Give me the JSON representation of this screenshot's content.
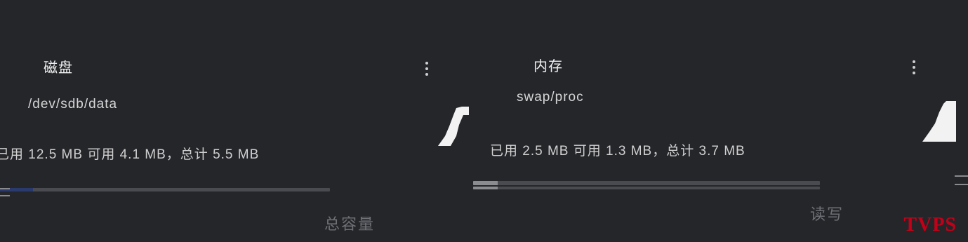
{
  "left_card": {
    "title": "磁盘",
    "subtitle": "/dev/sdb/data",
    "stats": "已用 12.5 MB 可用 4.1 MB，总计 5.5 MB",
    "progress_fraction": 0.1,
    "menu_icon": "more-vertical-icon",
    "footer_label": "总容量"
  },
  "right_card": {
    "title": "内存",
    "subtitle": "swap/proc",
    "stats": "已用 2.5 MB 可用 1.3 MB，总计 3.7 MB",
    "progress_fraction": 0.07,
    "menu_icon": "more-vertical-icon",
    "footer_label": "读写"
  },
  "brand_text": "TVPS",
  "colors": {
    "background": "#25262a",
    "track": "#4a4b50",
    "fill_left": "#2a3a6c",
    "fill_right": "#8b8c90",
    "brand": "#c40018"
  }
}
